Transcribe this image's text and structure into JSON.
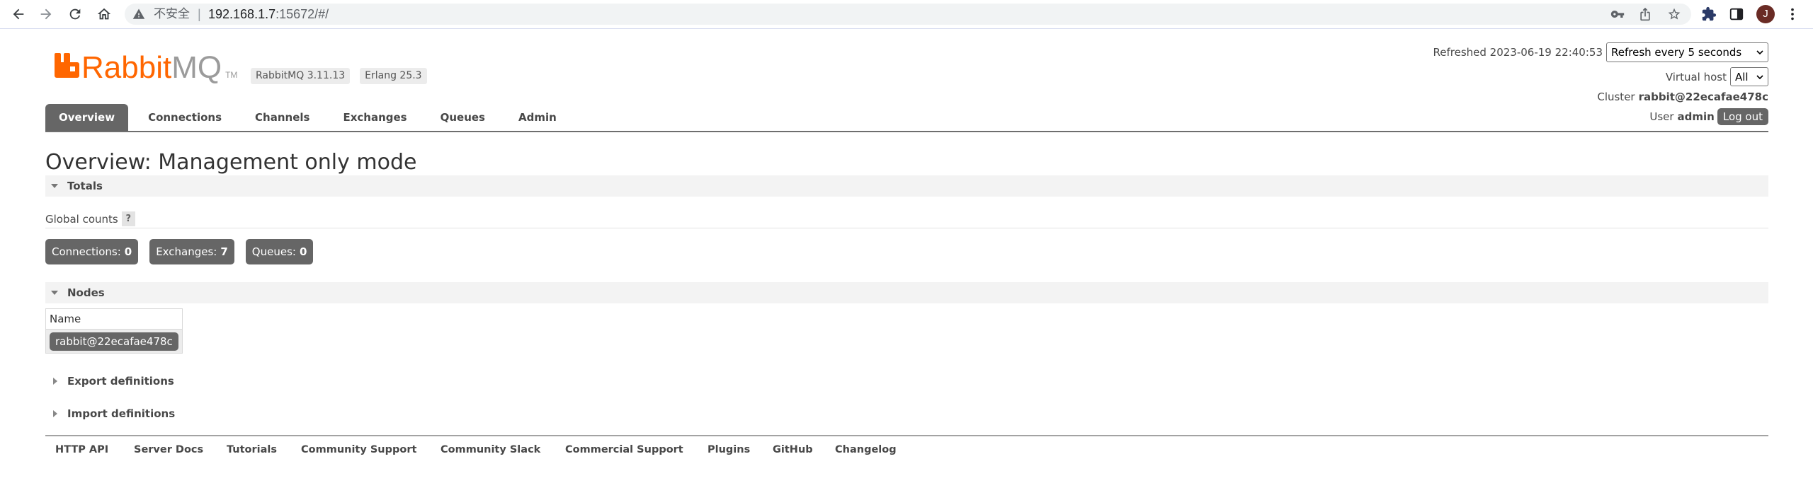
{
  "browser": {
    "security_label": "不安全",
    "separator": "|",
    "url_host": "192.168.1.7",
    "url_path": ":15672/#/",
    "profile_initial": "J",
    "icons": [
      "back-arrow-icon",
      "forward-arrow-icon",
      "reload-icon",
      "home-icon",
      "warning-icon",
      "key-icon",
      "share-icon",
      "star-icon",
      "extensions-puzzle-icon",
      "side-panel-icon",
      "more-vert-icon"
    ]
  },
  "header": {
    "logo": {
      "word_rabbit": "Rabbit",
      "word_mq": "MQ",
      "trademark": "TM",
      "icon": "rabbitmq-logo-icon"
    },
    "badges": [
      {
        "label": "RabbitMQ 3.11.13"
      },
      {
        "label": "Erlang 25.3"
      }
    ],
    "refreshed": "Refreshed 2023-06-19 22:40:53",
    "refresh_select": {
      "selected": "Refresh every 5 seconds"
    },
    "virtual_host": {
      "label": "Virtual host",
      "selected": "All"
    },
    "cluster": {
      "label": "Cluster",
      "name": "rabbit@22ecafae478c"
    },
    "user": {
      "label": "User",
      "name": "admin",
      "logout_label": "Log out"
    }
  },
  "nav": {
    "tabs": [
      {
        "label": "Overview",
        "active": true
      },
      {
        "label": "Connections",
        "active": false
      },
      {
        "label": "Channels",
        "active": false
      },
      {
        "label": "Exchanges",
        "active": false
      },
      {
        "label": "Queues",
        "active": false
      },
      {
        "label": "Admin",
        "active": false
      }
    ]
  },
  "main": {
    "title": "Overview: Management only mode",
    "totals": {
      "heading": "Totals",
      "expanded": true,
      "global_counts_label": "Global counts",
      "help_label": "?",
      "counts": [
        {
          "label": "Connections:",
          "value": "0"
        },
        {
          "label": "Exchanges:",
          "value": "7"
        },
        {
          "label": "Queues:",
          "value": "0"
        }
      ]
    },
    "nodes": {
      "heading": "Nodes",
      "expanded": true,
      "columns": [
        "Name"
      ],
      "rows": [
        {
          "name": "rabbit@22ecafae478c"
        }
      ]
    },
    "sections": [
      {
        "label": "Export definitions",
        "expanded": false
      },
      {
        "label": "Import definitions",
        "expanded": false
      }
    ]
  },
  "footer": {
    "links": [
      {
        "label": "HTTP API"
      },
      {
        "label": "Server Docs"
      },
      {
        "label": "Tutorials"
      },
      {
        "label": "Community Support"
      },
      {
        "label": "Community Slack"
      },
      {
        "label": "Commercial Support"
      },
      {
        "label": "Plugins"
      },
      {
        "label": "GitHub"
      },
      {
        "label": "Changelog"
      }
    ]
  },
  "colors": {
    "brand": "#ff6600",
    "badge": "#666666",
    "band": "#f3f3f3",
    "text": "#484848",
    "avatar": "#6a2b25"
  }
}
